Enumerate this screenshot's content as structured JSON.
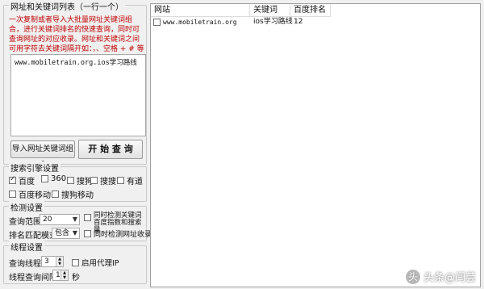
{
  "left_panel": {
    "url_group": {
      "title": "网址和关键词列表（一行一个）",
      "instructions": "一次复制或者导入大批量网址关键词组合，进行关键词排名的快速查询，同时可查询网址的对应收录。网址和关键词之间可用字符去关键词隔开如：，、空格 + # 等 （非中英文及数字和-）",
      "textarea_value": "www.mobiletrain.org.ios学习路线",
      "import_label": "导入网址关键词组合",
      "start_label": "开 始 查 询"
    },
    "engine_group": {
      "title": "搜索引擎设置",
      "engines": [
        {
          "label": "百度",
          "checked": true
        },
        {
          "label": "360",
          "checked": false
        },
        {
          "label": "搜狗",
          "checked": false
        },
        {
          "label": "搜搜",
          "checked": false
        },
        {
          "label": "有道",
          "checked": false
        },
        {
          "label": "百度移动",
          "checked": false
        },
        {
          "label": "搜狗移动",
          "checked": false
        }
      ]
    },
    "detect_group": {
      "title": "检测设置",
      "range_label": "查询范围：",
      "range_value": "20",
      "detect_site_label": "同时检测关键词百度指数和搜索量",
      "match_label": "排名匹配模式：",
      "match_value": "包含",
      "detect_index_label": "同时检测网址收录"
    },
    "thread_group": {
      "title": "线程设置",
      "threads_label": "查询线程：",
      "threads_value": "3",
      "proxy_label": "启用代理IP",
      "interval_label": "线程查询间隔：",
      "interval_value": "1",
      "interval_unit": "秒"
    }
  },
  "results": {
    "columns": [
      "网站",
      "关键词",
      "百度排名"
    ],
    "rows": [
      {
        "site": "www.mobiletrain.org",
        "keyword": "ios学习路线",
        "rank": "12"
      }
    ]
  },
  "watermark": {
    "logo_text": "头",
    "text": "头条@闫芸"
  }
}
